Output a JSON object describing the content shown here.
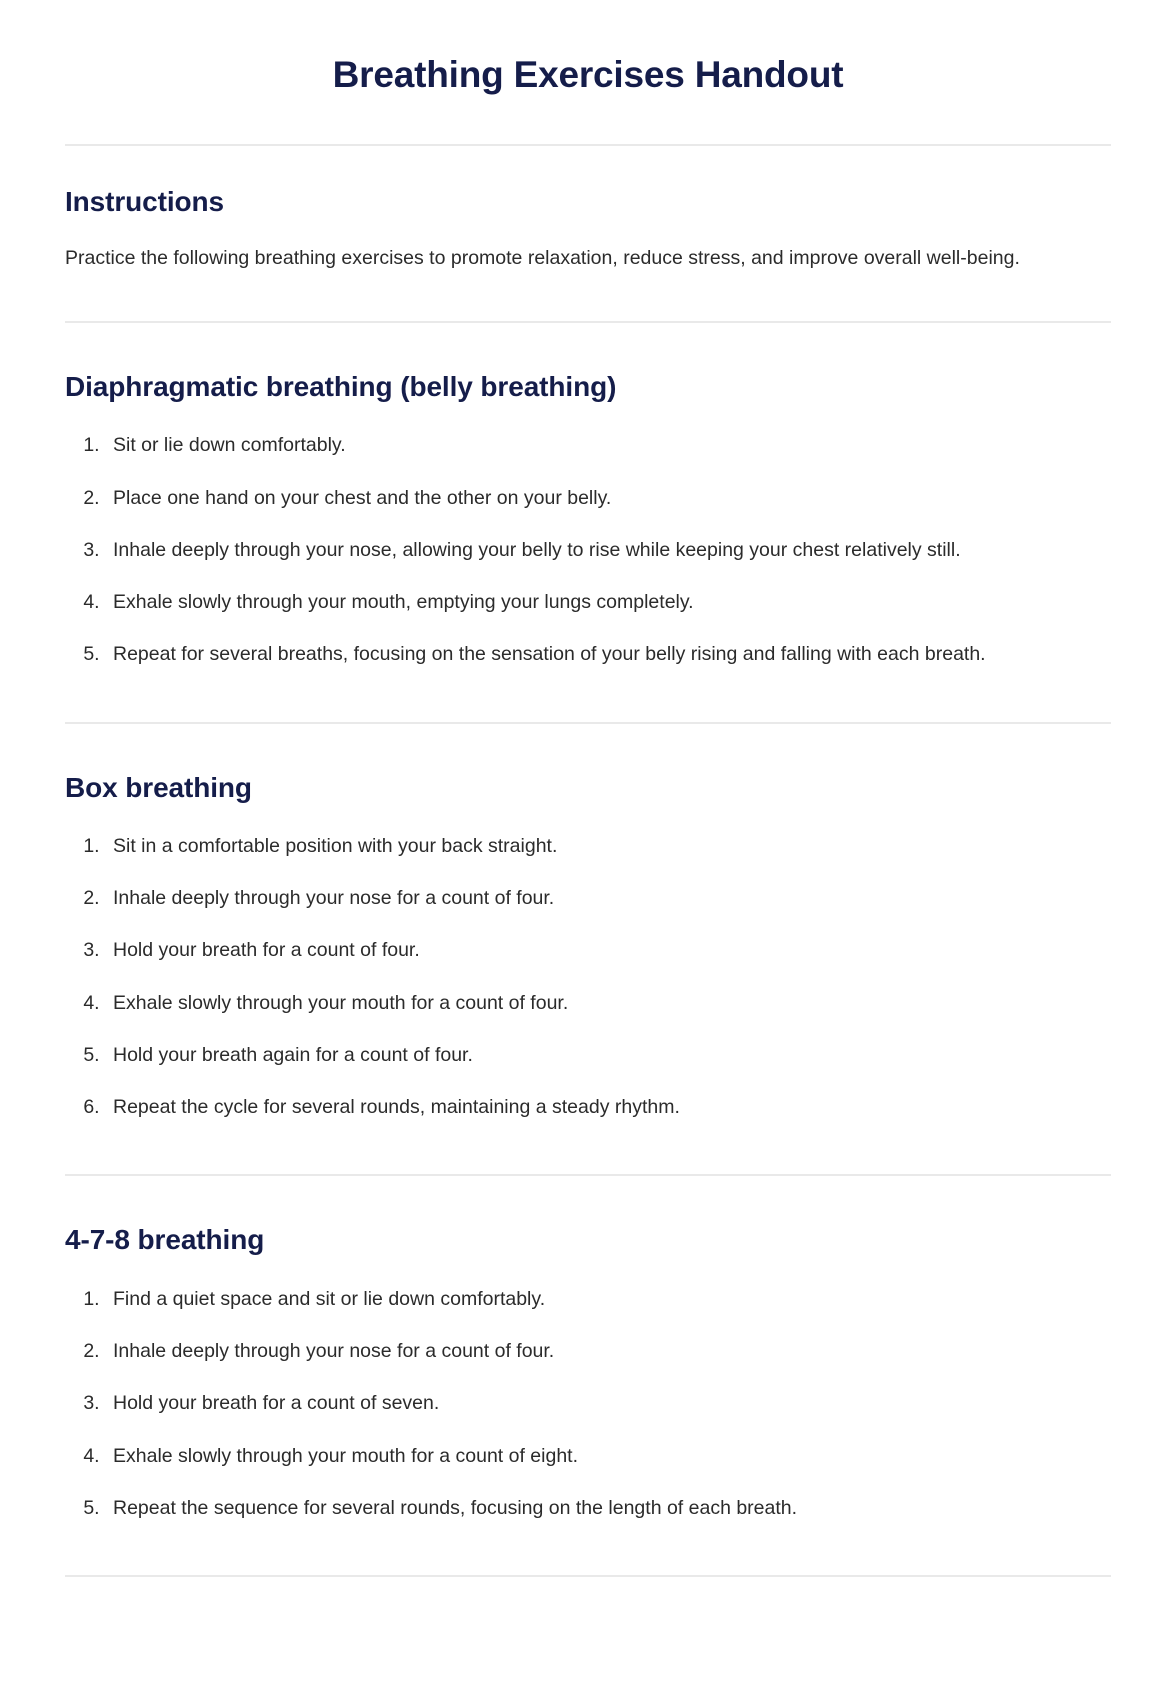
{
  "document": {
    "title": "Breathing Exercises Handout",
    "colors": {
      "heading_navy": "#151d4a",
      "body_text": "#2b2b2b",
      "divider": "#e9e9e9",
      "background": "#ffffff"
    }
  },
  "instructions": {
    "heading": "Instructions",
    "text": "Practice the following breathing exercises to promote relaxation, reduce stress, and improve overall well-being."
  },
  "sections": [
    {
      "heading": "Diaphragmatic breathing (belly breathing)",
      "steps": [
        "Sit or lie down comfortably.",
        "Place one hand on your chest and the other on your belly.",
        "Inhale deeply through your nose, allowing your belly to rise while keeping your chest relatively still.",
        "Exhale slowly through your mouth, emptying your lungs completely.",
        "Repeat for several breaths, focusing on the sensation of your belly rising and falling with each breath."
      ]
    },
    {
      "heading": "Box breathing",
      "steps": [
        "Sit in a comfortable position with your back straight.",
        "Inhale deeply through your nose for a count of four.",
        "Hold your breath for a count of four.",
        "Exhale slowly through your mouth for a count of four.",
        "Hold your breath again for a count of four.",
        "Repeat the cycle for several rounds, maintaining a steady rhythm."
      ]
    },
    {
      "heading": "4-7-8 breathing",
      "steps": [
        "Find a quiet space and sit or lie down comfortably.",
        "Inhale deeply through your nose for a count of four.",
        "Hold your breath for a count of seven.",
        "Exhale slowly through your mouth for a count of eight.",
        "Repeat the sequence for several rounds, focusing on the length of each breath."
      ]
    }
  ]
}
